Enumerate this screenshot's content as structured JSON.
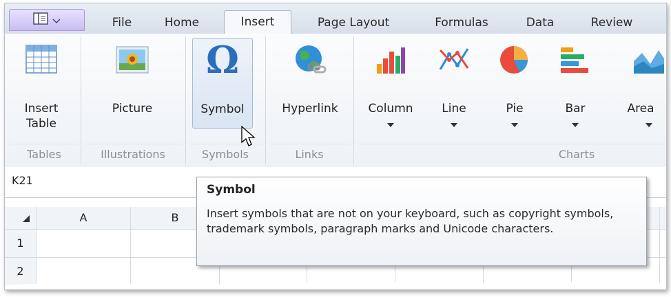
{
  "tabs": {
    "file": "File",
    "home": "Home",
    "insert": "Insert",
    "page_layout": "Page Layout",
    "formulas": "Formulas",
    "data": "Data",
    "review": "Review"
  },
  "ribbon": {
    "insert_table": {
      "line1": "Insert",
      "line2": "Table"
    },
    "picture": "Picture",
    "symbol": "Symbol",
    "hyperlink": "Hyperlink",
    "column": "Column",
    "line": "Line",
    "pie": "Pie",
    "bar": "Bar",
    "area": "Area",
    "groups": {
      "tables": "Tables",
      "illustrations": "Illustrations",
      "symbols": "Symbols",
      "links": "Links",
      "charts": "Charts"
    }
  },
  "namebox": {
    "value": "K21"
  },
  "grid": {
    "columns": [
      "A",
      "B"
    ],
    "rows": [
      "1",
      "2"
    ]
  },
  "tooltip": {
    "title": "Symbol",
    "body": "Insert symbols that are not on your keyboard, such as copyright symbols, trademark symbols, paragraph marks and Unicode characters."
  },
  "colors": {
    "accent_active_tab": "#f6f8fb",
    "symbol_hover": "#d9e5f3",
    "omega": "#2a6ebc"
  }
}
